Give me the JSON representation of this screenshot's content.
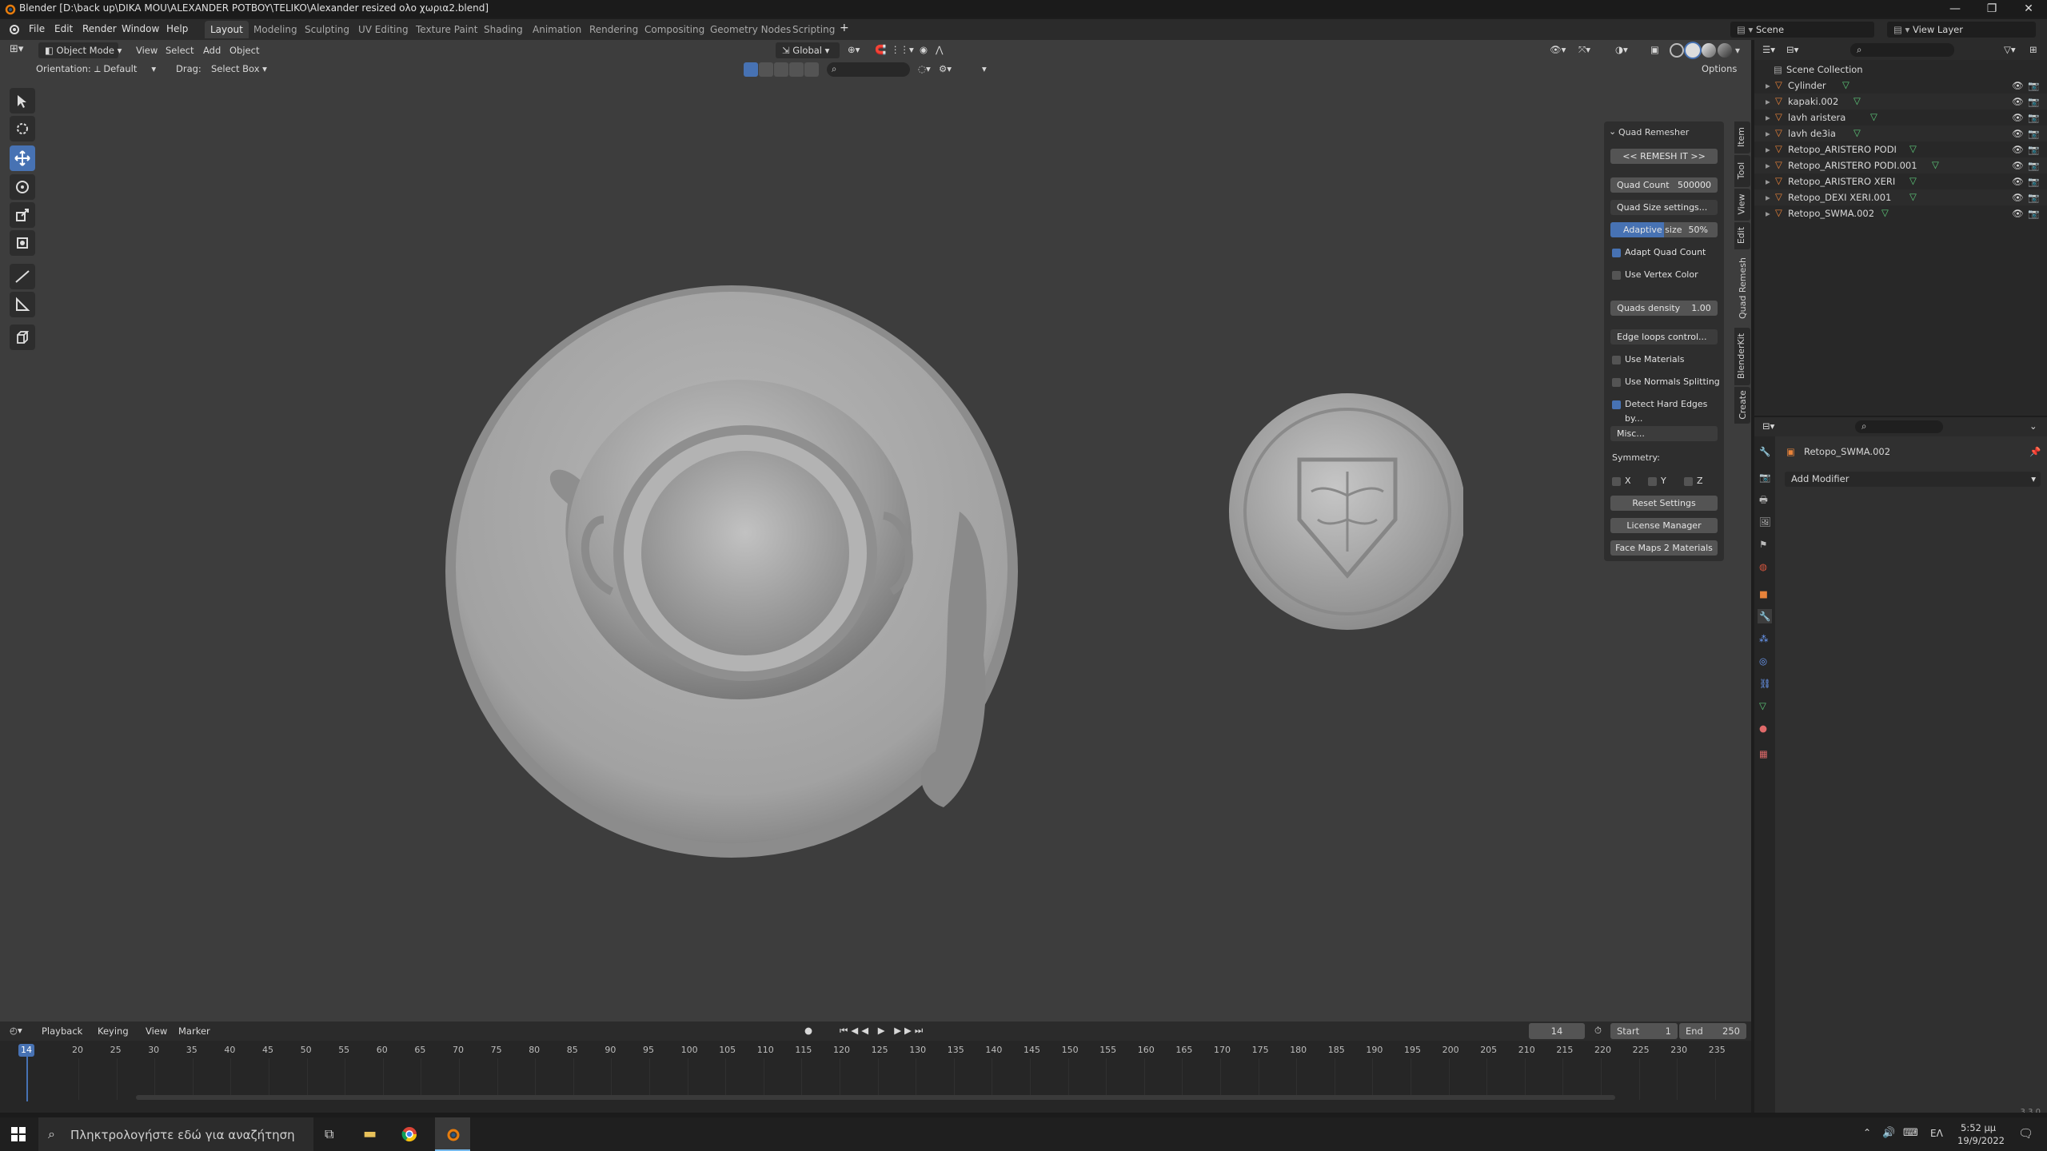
{
  "window": {
    "title": "Blender [D:\\back up\\DIKA MOU\\ALEXANDER POTBOY\\TELIKO\\Alexander resized  ολο χωρια2.blend]"
  },
  "menus": [
    "File",
    "Edit",
    "Render",
    "Window",
    "Help"
  ],
  "workspaces": [
    {
      "label": "Layout",
      "active": true
    },
    {
      "label": "Modeling"
    },
    {
      "label": "Sculpting"
    },
    {
      "label": "UV Editing"
    },
    {
      "label": "Texture Paint"
    },
    {
      "label": "Shading"
    },
    {
      "label": "Animation"
    },
    {
      "label": "Rendering"
    },
    {
      "label": "Compositing"
    },
    {
      "label": "Geometry Nodes"
    },
    {
      "label": "Scripting"
    }
  ],
  "scene": {
    "label": "Scene"
  },
  "view_layer": {
    "label": "View Layer"
  },
  "viewport_header": {
    "mode": "Object Mode",
    "menus": [
      "View",
      "Select",
      "Add",
      "Object"
    ],
    "transform_orientation": "Global",
    "orientation_label": "Orientation:",
    "orientation_value": "Default",
    "drag_label": "Drag:",
    "drag_value": "Select Box",
    "options": "Options"
  },
  "quad_remesher": {
    "title": "Quad Remesher",
    "remesh_button": "<< REMESH IT >>",
    "quad_count_label": "Quad Count",
    "quad_count_value": "500000",
    "quad_size_settings": "Quad Size settings...",
    "adaptive_size_label": "Adaptive size",
    "adaptive_size_value": "50%",
    "adaptive_size_fraction": 0.5,
    "adapt_quad_count": {
      "label": "Adapt Quad Count",
      "checked": true
    },
    "use_vertex_color": {
      "label": "Use Vertex Color",
      "checked": false
    },
    "quads_density_label": "Quads density",
    "quads_density_value": "1.00",
    "edge_loops_control": "Edge loops control...",
    "use_materials": {
      "label": "Use Materials",
      "checked": false
    },
    "use_normals_splitting": {
      "label": "Use Normals Splitting",
      "checked": false
    },
    "detect_hard_edges": {
      "label": "Detect Hard Edges by...",
      "checked": true
    },
    "misc": "Misc...",
    "symmetry_label": "Symmetry:",
    "symmetry_axes": [
      "X",
      "Y",
      "Z"
    ],
    "reset_settings": "Reset Settings",
    "license_manager": "License Manager",
    "face_maps": "Face Maps 2 Materials"
  },
  "sidebar_tabs": [
    "Item",
    "Tool",
    "View",
    "Edit",
    "Quad Remesh",
    "BlenderKit",
    "Create"
  ],
  "outliner": {
    "collection": "Scene Collection",
    "items": [
      {
        "name": "Cylinder"
      },
      {
        "name": "kapaki.002"
      },
      {
        "name": "lavh aristera"
      },
      {
        "name": "lavh de3ia"
      },
      {
        "name": "Retopo_ARISTERO PODI"
      },
      {
        "name": "Retopo_ARISTERO PODI.001"
      },
      {
        "name": "Retopo_ARISTERO XERI"
      },
      {
        "name": "Retopo_DEXI XERI.001"
      },
      {
        "name": "Retopo_SWMA.002"
      }
    ]
  },
  "properties": {
    "object_name": "Retopo_SWMA.002",
    "add_modifier": "Add Modifier"
  },
  "timeline": {
    "menus": [
      "Playback",
      "Keying",
      "View",
      "Marker"
    ],
    "current_frame": "14",
    "start_label": "Start",
    "start_value": "1",
    "end_label": "End",
    "end_value": "250",
    "ruler_current": "14",
    "ruler_ticks": [
      "20",
      "25",
      "30",
      "35",
      "40",
      "45",
      "50",
      "55",
      "60",
      "65",
      "70",
      "75",
      "80",
      "85",
      "90",
      "95",
      "100",
      "105",
      "110",
      "115",
      "120",
      "125",
      "130",
      "135",
      "140",
      "145",
      "150",
      "155",
      "160",
      "165",
      "170",
      "175",
      "180",
      "185",
      "190",
      "195",
      "200",
      "205",
      "210",
      "215",
      "220",
      "225",
      "230",
      "235"
    ]
  },
  "status": {
    "version": "3.3.0"
  },
  "taskbar": {
    "search_placeholder": "Πληκτρολογήστε εδώ για αναζήτηση",
    "language": "ΕΛ",
    "time": "5:52 μμ",
    "date": "19/9/2022"
  },
  "colors": {
    "accent": "#4772b3",
    "viewport_bg": "#3d3d3d",
    "mesh_icon": "#e8833a",
    "mesh_data": "#5ecb7b"
  }
}
